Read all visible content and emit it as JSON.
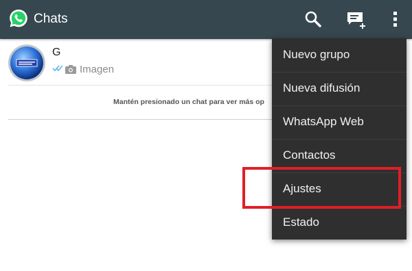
{
  "appbar": {
    "title": "Chats",
    "logo_icon": "whatsapp-logo-icon",
    "actions": [
      {
        "name": "search",
        "icon": "search-icon"
      },
      {
        "name": "new-chat",
        "icon": "new-chat-icon"
      },
      {
        "name": "overflow-menu",
        "icon": "more-vert-icon"
      }
    ],
    "background": "#36474f"
  },
  "chats": [
    {
      "name": "G",
      "preview": "Imagen",
      "status_icon": "double-check-icon",
      "media_icon": "camera-icon",
      "avatar_icon": "group-avatar-icon"
    }
  ],
  "hint": "Mantén presionado un chat para ver más op",
  "menu": {
    "background": "#2f2f2f",
    "items": [
      {
        "label": "Nuevo grupo"
      },
      {
        "label": "Nueva difusión"
      },
      {
        "label": "WhatsApp Web"
      },
      {
        "label": "Contactos"
      },
      {
        "label": "Ajustes"
      },
      {
        "label": "Estado"
      }
    ]
  },
  "highlight": {
    "color": "#e01e27",
    "target": "Ajustes"
  }
}
